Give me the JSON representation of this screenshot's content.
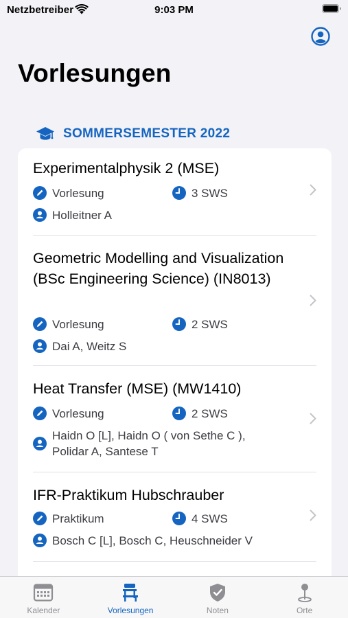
{
  "status_bar": {
    "carrier": "Netzbetreiber",
    "time": "9:03 PM"
  },
  "header": {
    "title": "Vorlesungen",
    "profile_icon": "person-circle-icon"
  },
  "section": {
    "title": "SOMMERSEMESTER 2022",
    "icon": "graduation-cap-icon"
  },
  "lectures": [
    {
      "title": "Experimentalphysik 2 (MSE)",
      "type": "Vorlesung",
      "sws": "3 SWS",
      "lecturers": "Holleitner A"
    },
    {
      "title": "Geometric Modelling and Visualization (BSc Engineering Science) (IN8013)",
      "type": "Vorlesung",
      "sws": "2 SWS",
      "lecturers": "Dai A, Weitz S"
    },
    {
      "title": "Heat Transfer (MSE) (MW1410)",
      "type": "Vorlesung",
      "sws": "2 SWS",
      "lecturers": "Haidn O [L], Haidn O ( von Sethe C ), Polidar A, Santese T"
    },
    {
      "title": "IFR-Praktikum Hubschrauber",
      "type": "Praktikum",
      "sws": "4 SWS",
      "lecturers": "Bosch C [L], Bosch C, Heuschneider V"
    }
  ],
  "tabs": [
    {
      "label": "Kalender",
      "icon": "calendar-icon",
      "active": false
    },
    {
      "label": "Vorlesungen",
      "icon": "lecture-desk-icon",
      "active": true
    },
    {
      "label": "Noten",
      "icon": "shield-check-icon",
      "active": false
    },
    {
      "label": "Orte",
      "icon": "map-pin-icon",
      "active": false
    }
  ],
  "colors": {
    "accent": "#1565c0",
    "background": "#f2f2f7",
    "inactive_tab": "#8e8e93"
  }
}
